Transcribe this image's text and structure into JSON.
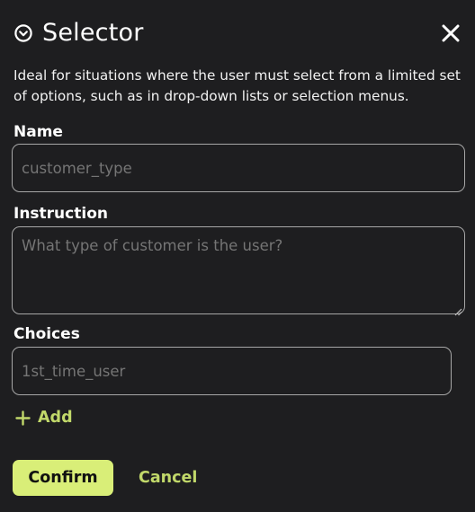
{
  "dialog": {
    "title": "Selector",
    "icon": "chevron-circle-icon",
    "close_icon": "close-icon",
    "description": "Ideal for situations where the user must select from a limited set of options, such as in drop-down lists or selection menus."
  },
  "form": {
    "name_label": "Name",
    "name_placeholder": "customer_type",
    "instruction_label": "Instruction",
    "instruction_placeholder": "What type of customer is the user?",
    "choices_label": "Choices",
    "choices": [
      {
        "placeholder": "1st_time_user"
      }
    ],
    "add_label": "Add"
  },
  "actions": {
    "confirm_label": "Confirm",
    "cancel_label": "Cancel"
  },
  "colors": {
    "background": "#1e1e20",
    "accent": "#d9ee78",
    "accent_text": "#c1d86a",
    "border": "#a7a7a7"
  }
}
